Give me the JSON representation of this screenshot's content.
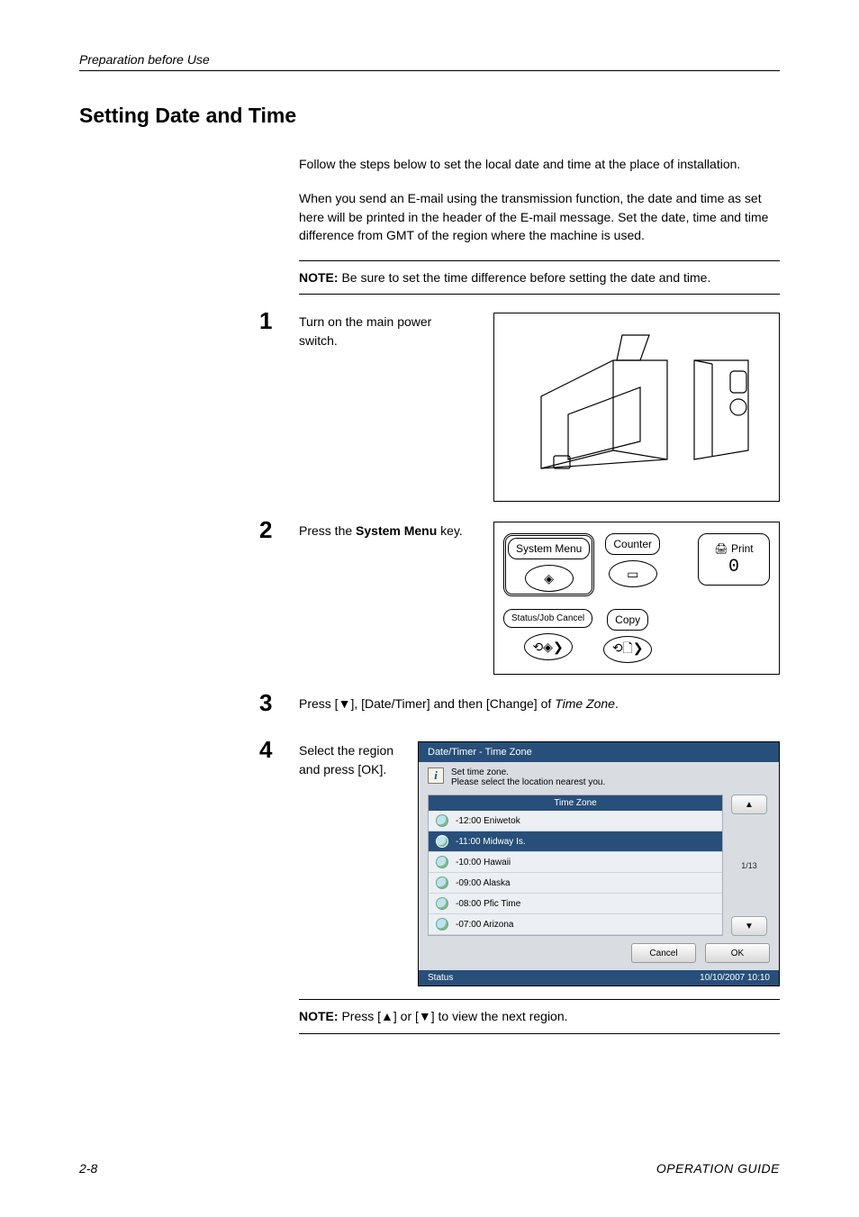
{
  "running_head": "Preparation before Use",
  "section_title": "Setting Date and Time",
  "intro_p1": "Follow the steps below to set the local date and time at the place of installation.",
  "intro_p2": "When you send an E-mail using the transmission function, the date and time as set here will be printed in the header of the E-mail message. Set the date, time and time difference from GMT of the region where the machine is used.",
  "note1_label": "NOTE:",
  "note1_text": " Be sure to set the time difference before setting the date and time.",
  "steps": {
    "s1": {
      "num": "1",
      "text": "Turn on the main power switch."
    },
    "s2": {
      "num": "2",
      "text_pre": "Press the ",
      "text_bold": "System Menu",
      "text_post": " key."
    },
    "s3": {
      "num": "3",
      "text_pre": "Press [",
      "arrow": "▼",
      "text_mid": "], [Date/Timer] and then [Change] of ",
      "italic": "Time Zone",
      "text_post": "."
    },
    "s4": {
      "num": "4",
      "text": "Select the region and press [OK]."
    }
  },
  "panel": {
    "system_menu": "System Menu",
    "counter": "Counter",
    "print": "Print",
    "zero": "0",
    "status_job": "Status/Job Cancel",
    "copy": "Copy"
  },
  "tz": {
    "title": "Date/Timer - Time Zone",
    "instr_l1": "Set time zone.",
    "instr_l2": "Please select the location nearest you.",
    "list_header": "Time Zone",
    "rows": [
      "-12:00 Eniwetok",
      "-11:00 Midway Is.",
      "-10:00 Hawaii",
      "-09:00 Alaska",
      "-08:00 Pfic Time",
      "-07:00 Arizona"
    ],
    "page_indicator": "1/13",
    "cancel": "Cancel",
    "ok": "OK",
    "status": "Status",
    "datetime": "10/10/2007   10:10"
  },
  "note2_label": "NOTE:",
  "note2_pre": " Press [",
  "note2_up": "▲",
  "note2_mid": "] or [",
  "note2_down": "▼",
  "note2_post": "] to view the next region.",
  "footer": {
    "page": "2-8",
    "guide": "OPERATION GUIDE"
  }
}
